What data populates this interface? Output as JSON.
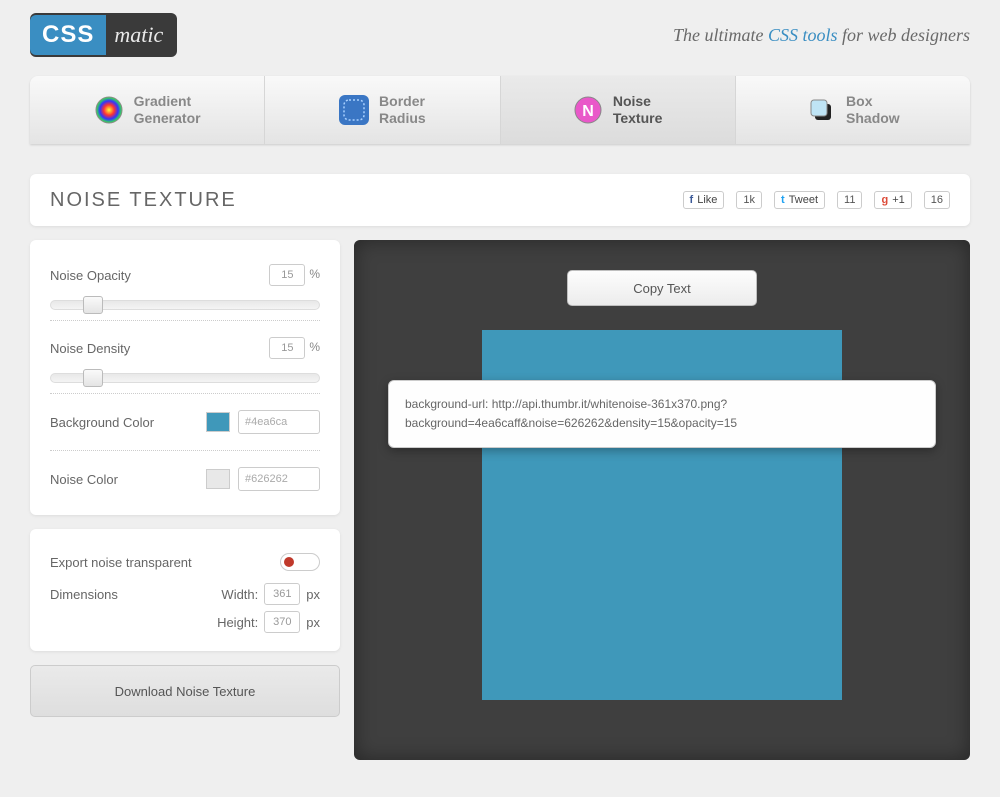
{
  "logo": {
    "css": "CSS",
    "matic": "matic"
  },
  "tagline": {
    "pre": "The ultimate ",
    "highlight": "CSS tools",
    "post": " for web designers"
  },
  "tabs": {
    "gradient": {
      "line1": "Gradient",
      "line2": "Generator"
    },
    "border": {
      "line1": "Border",
      "line2": "Radius"
    },
    "noise": {
      "line1": "Noise",
      "line2": "Texture"
    },
    "shadow": {
      "line1": "Box",
      "line2": "Shadow"
    }
  },
  "page_title": "NOISE TEXTURE",
  "social": {
    "fb_label": "Like",
    "fb_count": "1k",
    "tw_label": "Tweet",
    "tw_count": "11",
    "gp_label": "+1",
    "gp_count": "16"
  },
  "controls": {
    "opacity_label": "Noise Opacity",
    "opacity_value": "15",
    "opacity_unit": "%",
    "density_label": "Noise Density",
    "density_value": "15",
    "density_unit": "%",
    "bgcolor_label": "Background Color",
    "bgcolor_value": "#4ea6ca",
    "bgcolor_swatch": "#3f98ba",
    "noisecolor_label": "Noise Color",
    "noisecolor_value": "#626262",
    "noisecolor_swatch": "#e8e8e8",
    "export_label": "Export noise transparent",
    "dimensions_label": "Dimensions",
    "width_label": "Width:",
    "width_value": "361",
    "width_unit": "px",
    "height_label": "Height:",
    "height_value": "370",
    "height_unit": "px"
  },
  "download_label": "Download Noise Texture",
  "copy_label": "Copy Text",
  "code_line1": "background-url: http://api.thumbr.it/whitenoise-361x370.png?",
  "code_line2": "background=4ea6caff&noise=626262&density=15&opacity=15"
}
